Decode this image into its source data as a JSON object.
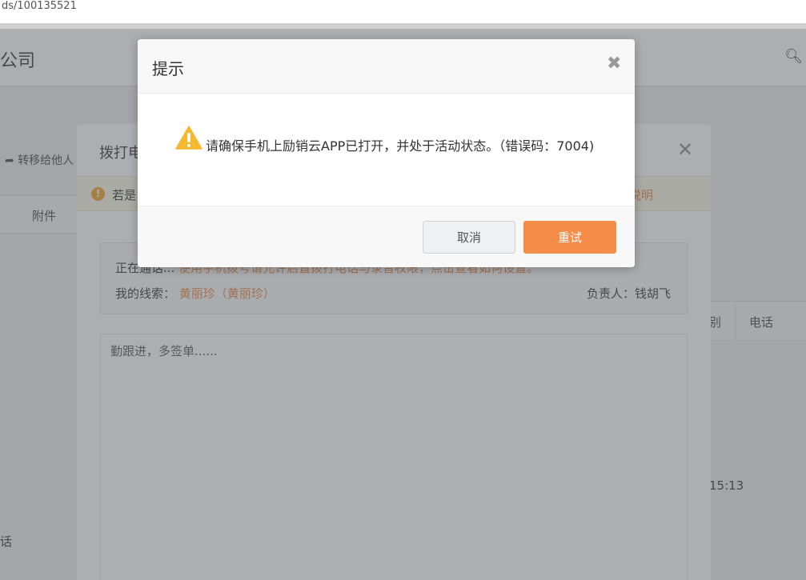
{
  "browser": {
    "url_fragment": "ds/100135521"
  },
  "app": {
    "company_fragment": "公司",
    "transfer_label": "转移给他人",
    "attachment_col": "附件",
    "table_cols": [
      "别",
      "电话"
    ],
    "time_fragment": "15:13",
    "left_bottom_fragment": "话"
  },
  "call_dialog": {
    "title": "拨打电话",
    "tip_text": "若是",
    "tip_link": "说明",
    "status_prefix": "正在通话...",
    "status_warning": "使用手机拨号请允许启置拨打电话与录音权限，点击查看如何设置。",
    "lead_label": "我的线索：",
    "lead_value": "黄丽珍（黄丽珍）",
    "owner": "负责人：钱胡飞",
    "notes_placeholder": "勤跟进，多签单......"
  },
  "alert": {
    "title": "提示",
    "message": "请确保手机上励销云APP已打开，并处于活动状态。（错误码：7004)",
    "cancel_label": "取消",
    "retry_label": "重试",
    "warning_color": "#f5b82e",
    "retry_color": "#f58c48"
  }
}
